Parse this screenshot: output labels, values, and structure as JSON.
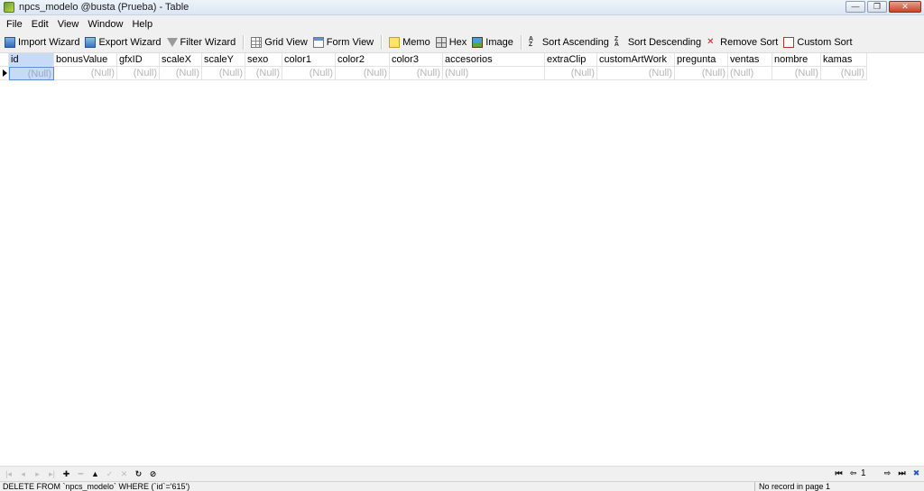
{
  "window": {
    "title": "npcs_modelo @busta (Prueba) - Table",
    "buttons": {
      "minimize": "—",
      "restore": "❐",
      "close": "✕"
    }
  },
  "menu": [
    "File",
    "Edit",
    "View",
    "Window",
    "Help"
  ],
  "toolbar": {
    "import_wizard": "Import Wizard",
    "export_wizard": "Export Wizard",
    "filter_wizard": "Filter Wizard",
    "grid_view": "Grid View",
    "form_view": "Form View",
    "memo": "Memo",
    "hex": "Hex",
    "image": "Image",
    "sort_ascending": "Sort Ascending",
    "sort_descending": "Sort Descending",
    "remove_sort": "Remove Sort",
    "custom_sort": "Custom Sort"
  },
  "grid": {
    "columns": [
      "id",
      "bonusValue",
      "gfxID",
      "scaleX",
      "scaleY",
      "sexo",
      "color1",
      "color2",
      "color3",
      "accesorios",
      "extraClip",
      "customArtWork",
      "pregunta",
      "ventas",
      "nombre",
      "kamas"
    ],
    "rows": [
      [
        "(Null)",
        "(Null)",
        "(Null)",
        "(Null)",
        "(Null)",
        "(Null)",
        "(Null)",
        "(Null)",
        "(Null)",
        "(Null)",
        "(Null)",
        "(Null)",
        "(Null)",
        "(Null)",
        "(Null)",
        "(Null)"
      ]
    ]
  },
  "nav": {
    "buttons": [
      "first",
      "prev",
      "next",
      "last",
      "add",
      "delete",
      "up",
      "post",
      "cancel",
      "refresh",
      "stop"
    ],
    "page": "1"
  },
  "status": {
    "sql": "DELETE FROM `npcs_modelo` WHERE (`id`='615')",
    "record": "No record in page 1"
  }
}
